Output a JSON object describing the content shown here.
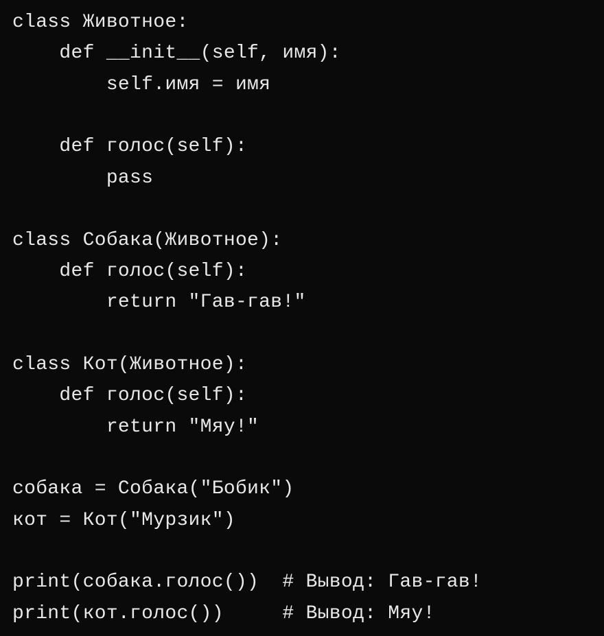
{
  "code": {
    "line1": "class Животное:",
    "line2": "    def __init__(self, имя):",
    "line3": "        self.имя = имя",
    "line4": "",
    "line5": "    def голос(self):",
    "line6": "        pass",
    "line7": "",
    "line8": "class Собака(Животное):",
    "line9": "    def голос(self):",
    "line10": "        return \"Гав-гав!\"",
    "line11": "",
    "line12": "class Кот(Животное):",
    "line13": "    def голос(self):",
    "line14": "        return \"Мяу!\"",
    "line15": "",
    "line16": "собака = Собака(\"Бобик\")",
    "line17": "кот = Кот(\"Мурзик\")",
    "line18": "",
    "line19": "print(собака.голос())  # Вывод: Гав-гав!",
    "line20": "print(кот.голос())     # Вывод: Мяу!"
  }
}
